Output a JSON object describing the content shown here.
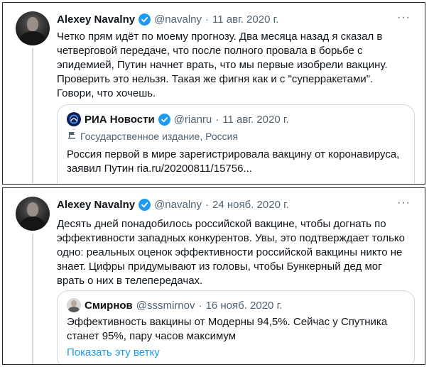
{
  "tweets": [
    {
      "author_name": "Alexey Navalny",
      "author_handle": "@navalny",
      "separator": "·",
      "date": "11 авг. 2020 г.",
      "more_icon": "···",
      "text": "Четко прям идёт по моему прогнозу. Два месяца назад я сказал в четверговой передаче, что после полного провала в борьбе с эпидемией, Путин начнет врать, что мы первые изобрели вакцину. Проверить это нельзя. Такая же фигня как и с \"суперракетами\". Говори, что хочешь.",
      "quote": {
        "author_name": "РИА Новости",
        "author_handle": "@rianru",
        "separator": "·",
        "date": "11 авг. 2020 г.",
        "label": "Государственное издание, Россия",
        "text": "Россия первой в мире зарегистрировала вакцину от коронавируса, заявил Путин ria.ru/20200811/15756..."
      }
    },
    {
      "author_name": "Alexey Navalny",
      "author_handle": "@navalny",
      "separator": "·",
      "date": "24 нояб. 2020 г.",
      "more_icon": "···",
      "text": "Десять дней понадобилось российской вакцине, чтобы догнать по эффективности западных конкурентов. Увы, это подтверждает только одно: реальных оценок эффективности российской вакцины никто не знает. Цифры придумывают из головы, чтобы Бункерный дед мог врать о них в телепередачах.",
      "quote": {
        "author_name": "Смирнов",
        "author_handle": "@sssmirnov",
        "separator": "·",
        "date": "16 нояб. 2020 г.",
        "text": "Эффективность вакцины от Модерны 94,5%. Сейчас у Спутника станет 95%, пару часов максимум",
        "show_thread": "Показать эту ветку"
      }
    }
  ],
  "colors": {
    "verified": "#1d9bf0",
    "link": "#1d9bf0",
    "secondary_text": "#536471",
    "border": "#cfd9de"
  }
}
